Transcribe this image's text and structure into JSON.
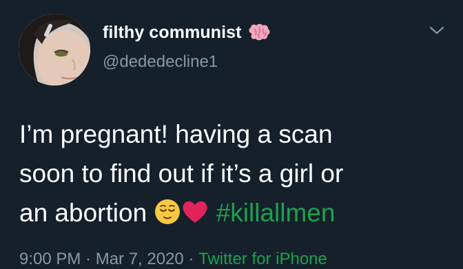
{
  "user": {
    "display_name": "filthy communist",
    "handle": "@dededecline1",
    "name_emoji": "brain-icon"
  },
  "tweet": {
    "line1": "I’m pregnant! having a scan",
    "line2": "soon to find out if it’s a girl or",
    "line3_text": "an abortion",
    "hashtag": "#killallmen",
    "emojis": [
      "relieved-face-icon",
      "red-heart-icon"
    ]
  },
  "meta": {
    "timestamp": "9:00 PM · Mar 7, 2020 ·",
    "source": "Twitter for iPhone"
  },
  "colors": {
    "background": "#15202b",
    "secondary_text": "#8899a6",
    "link": "#1da14f"
  }
}
